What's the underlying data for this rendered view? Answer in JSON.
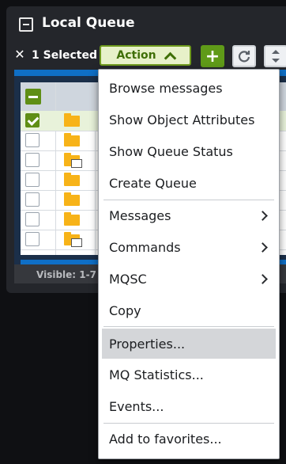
{
  "panel": {
    "title": "Local Queue"
  },
  "toolbar": {
    "selected_label": "1 Selected",
    "action_label": "Action",
    "add_label": "+"
  },
  "status": {
    "visible_text": "Visible: 1-7"
  },
  "menu": {
    "items": [
      {
        "label": "Browse messages"
      },
      {
        "label": "Show Object Attributes"
      },
      {
        "label": "Show Queue Status"
      },
      {
        "label": "Create Queue"
      },
      {
        "label": "Messages",
        "submenu": true
      },
      {
        "label": "Commands",
        "submenu": true
      },
      {
        "label": "MQSC",
        "submenu": true
      },
      {
        "label": "Copy"
      },
      {
        "label": "Properties...",
        "highlighted": true
      },
      {
        "label": "MQ Statistics..."
      },
      {
        "label": "Events..."
      },
      {
        "label": "Add to favorites..."
      }
    ]
  },
  "colors": {
    "accent_green": "#5f9a18",
    "grid_blue": "#0f6fc6",
    "folder_yellow": "#f7b318"
  }
}
